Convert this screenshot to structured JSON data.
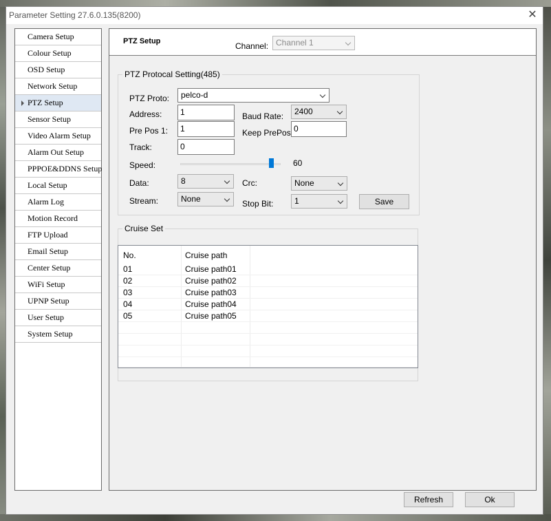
{
  "window": {
    "title": "Parameter Setting 27.6.0.135(8200)"
  },
  "nav": {
    "items": [
      {
        "label": "Camera Setup"
      },
      {
        "label": "Colour Setup"
      },
      {
        "label": "OSD Setup"
      },
      {
        "label": "Network Setup"
      },
      {
        "label": "PTZ Setup",
        "selected": true
      },
      {
        "label": "Sensor Setup"
      },
      {
        "label": "Video Alarm Setup"
      },
      {
        "label": "Alarm Out Setup"
      },
      {
        "label": "PPPOE&DDNS Setup"
      },
      {
        "label": "Local Setup"
      },
      {
        "label": "Alarm Log"
      },
      {
        "label": "Motion Record"
      },
      {
        "label": "FTP Upload"
      },
      {
        "label": "Email Setup"
      },
      {
        "label": "Center Setup"
      },
      {
        "label": "WiFi Setup"
      },
      {
        "label": "UPNP Setup"
      },
      {
        "label": "User Setup"
      },
      {
        "label": "System Setup"
      }
    ]
  },
  "header": {
    "title": "PTZ Setup",
    "channel_label": "Channel:",
    "channel_value": "Channel 1"
  },
  "ptz": {
    "group_title": "PTZ Protocal Setting(485)",
    "proto_label": "PTZ Proto:",
    "proto_value": "pelco-d",
    "address_label": "Address:",
    "address_value": "1",
    "baud_label": "Baud Rate:",
    "baud_value": "2400",
    "prepos_label": "Pre Pos 1:",
    "prepos_value": "1",
    "keep_prepos_label": "Keep PrePos",
    "keep_prepos_value": "0",
    "track_label": "Track:",
    "track_value": "0",
    "speed_label": "Speed:",
    "speed_value": "60",
    "speed_fraction": 0.93,
    "data_label": "Data:",
    "data_value": "8",
    "crc_label": "Crc:",
    "crc_value": "None",
    "stream_label": "Stream:",
    "stream_value": "None",
    "stopbit_label": "Stop Bit:",
    "stopbit_value": "1",
    "save_label": "Save"
  },
  "cruise": {
    "group_title": "Cruise Set",
    "columns": [
      "No.",
      "Cruise path"
    ],
    "rows": [
      {
        "no": "01",
        "path": "Cruise path01"
      },
      {
        "no": "02",
        "path": "Cruise path02"
      },
      {
        "no": "03",
        "path": "Cruise path03"
      },
      {
        "no": "04",
        "path": "Cruise path04"
      },
      {
        "no": "05",
        "path": "Cruise path05"
      }
    ]
  },
  "footer": {
    "refresh_label": "Refresh",
    "ok_label": "Ok"
  }
}
